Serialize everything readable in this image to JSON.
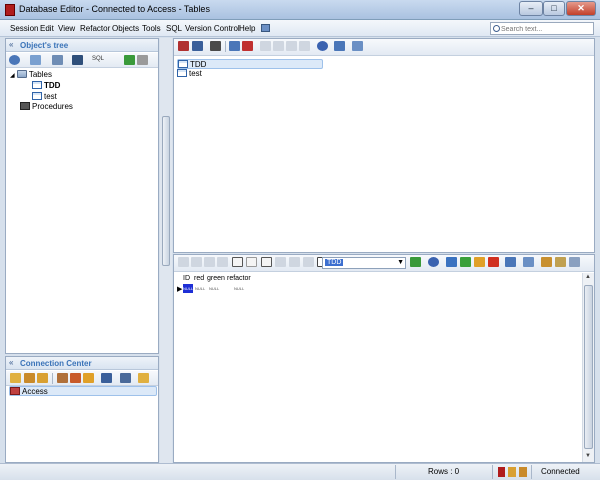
{
  "window": {
    "title": "Database Editor - Connected to Access - Tables",
    "min": "–",
    "max": "□",
    "close": "✕"
  },
  "menu": [
    "Session",
    "Edit",
    "View",
    "Refactor",
    "Objects",
    "Tools",
    "SQL",
    "Version Control",
    "Help"
  ],
  "search": {
    "placeholder": "Search text..."
  },
  "objects_tree": {
    "title": "Object's tree",
    "sql_label": "SQL",
    "tables_label": "Tables",
    "items": [
      "TDD",
      "test"
    ],
    "procedures_label": "Procedures"
  },
  "connection_center": {
    "title": "Connection Center",
    "connections": [
      "Access"
    ]
  },
  "tables_list": {
    "items": [
      "TDD",
      "test"
    ],
    "selected": "TDD"
  },
  "data_view": {
    "table_select": "TDD",
    "columns": [
      "ID",
      "red",
      "green",
      "refactor"
    ],
    "row": [
      "NULL",
      "NULL",
      "NULL",
      "NULL"
    ]
  },
  "status": {
    "rows": "Rows : 0",
    "connection": "Connected"
  },
  "colors": {
    "accent": "#3a73b8",
    "selection": "#3c6fd0",
    "close": "#c2402a"
  }
}
